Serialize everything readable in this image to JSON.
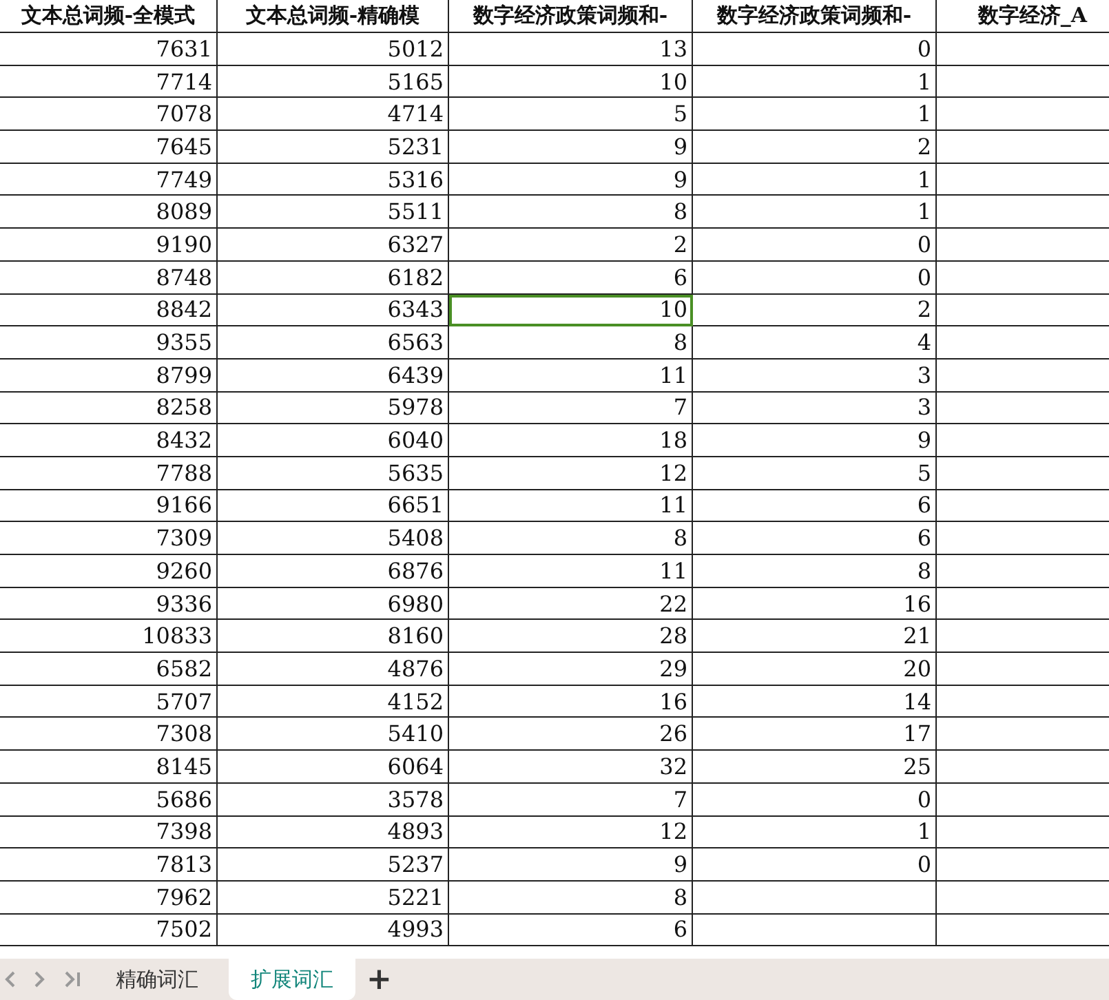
{
  "table": {
    "columns": [
      "文本总词频-全模式",
      "文本总词频-精确模",
      "数字经济政策词频和-",
      "数字经济政策词频和-",
      "数字经济_A"
    ],
    "rows": [
      {
        "cells": [
          {
            "text": "7631",
            "selected": false
          },
          {
            "text": "5012",
            "selected": false
          },
          {
            "text": "13",
            "selected": false
          },
          {
            "text": "0",
            "selected": false
          }
        ]
      },
      {
        "cells": [
          {
            "text": "7714",
            "selected": false
          },
          {
            "text": "5165",
            "selected": false
          },
          {
            "text": "10",
            "selected": false
          },
          {
            "text": "1",
            "selected": false
          }
        ]
      },
      {
        "cells": [
          {
            "text": "7078",
            "selected": false
          },
          {
            "text": "4714",
            "selected": false
          },
          {
            "text": "5",
            "selected": false
          },
          {
            "text": "1",
            "selected": false
          }
        ]
      },
      {
        "cells": [
          {
            "text": "7645",
            "selected": false
          },
          {
            "text": "5231",
            "selected": false
          },
          {
            "text": "9",
            "selected": false
          },
          {
            "text": "2",
            "selected": false
          }
        ]
      },
      {
        "cells": [
          {
            "text": "7749",
            "selected": false
          },
          {
            "text": "5316",
            "selected": false
          },
          {
            "text": "9",
            "selected": false
          },
          {
            "text": "1",
            "selected": false
          }
        ]
      },
      {
        "cells": [
          {
            "text": "8089",
            "selected": false
          },
          {
            "text": "5511",
            "selected": false
          },
          {
            "text": "8",
            "selected": false
          },
          {
            "text": "1",
            "selected": false
          }
        ]
      },
      {
        "cells": [
          {
            "text": "9190",
            "selected": false
          },
          {
            "text": "6327",
            "selected": false
          },
          {
            "text": "2",
            "selected": false
          },
          {
            "text": "0",
            "selected": false
          }
        ]
      },
      {
        "cells": [
          {
            "text": "8748",
            "selected": false
          },
          {
            "text": "6182",
            "selected": false
          },
          {
            "text": "6",
            "selected": false
          },
          {
            "text": "0",
            "selected": false
          }
        ]
      },
      {
        "cells": [
          {
            "text": "8842",
            "selected": false
          },
          {
            "text": "6343",
            "selected": false
          },
          {
            "text": "10",
            "selected": true
          },
          {
            "text": "2",
            "selected": false
          }
        ]
      },
      {
        "cells": [
          {
            "text": "9355",
            "selected": false
          },
          {
            "text": "6563",
            "selected": false
          },
          {
            "text": "8",
            "selected": false
          },
          {
            "text": "4",
            "selected": false
          }
        ]
      },
      {
        "cells": [
          {
            "text": "8799",
            "selected": false
          },
          {
            "text": "6439",
            "selected": false
          },
          {
            "text": "11",
            "selected": false
          },
          {
            "text": "3",
            "selected": false
          }
        ]
      },
      {
        "cells": [
          {
            "text": "8258",
            "selected": false
          },
          {
            "text": "5978",
            "selected": false
          },
          {
            "text": "7",
            "selected": false
          },
          {
            "text": "3",
            "selected": false
          }
        ]
      },
      {
        "cells": [
          {
            "text": "8432",
            "selected": false
          },
          {
            "text": "6040",
            "selected": false
          },
          {
            "text": "18",
            "selected": false
          },
          {
            "text": "9",
            "selected": false
          }
        ]
      },
      {
        "cells": [
          {
            "text": "7788",
            "selected": false
          },
          {
            "text": "5635",
            "selected": false
          },
          {
            "text": "12",
            "selected": false
          },
          {
            "text": "5",
            "selected": false
          }
        ]
      },
      {
        "cells": [
          {
            "text": "9166",
            "selected": false
          },
          {
            "text": "6651",
            "selected": false
          },
          {
            "text": "11",
            "selected": false
          },
          {
            "text": "6",
            "selected": false
          }
        ]
      },
      {
        "cells": [
          {
            "text": "7309",
            "selected": false
          },
          {
            "text": "5408",
            "selected": false
          },
          {
            "text": "8",
            "selected": false
          },
          {
            "text": "6",
            "selected": false
          }
        ]
      },
      {
        "cells": [
          {
            "text": "9260",
            "selected": false
          },
          {
            "text": "6876",
            "selected": false
          },
          {
            "text": "11",
            "selected": false
          },
          {
            "text": "8",
            "selected": false
          }
        ]
      },
      {
        "cells": [
          {
            "text": "9336",
            "selected": false
          },
          {
            "text": "6980",
            "selected": false
          },
          {
            "text": "22",
            "selected": false
          },
          {
            "text": "16",
            "selected": false
          }
        ]
      },
      {
        "cells": [
          {
            "text": "10833",
            "selected": false
          },
          {
            "text": "8160",
            "selected": false
          },
          {
            "text": "28",
            "selected": false
          },
          {
            "text": "21",
            "selected": false
          }
        ]
      },
      {
        "cells": [
          {
            "text": "6582",
            "selected": false
          },
          {
            "text": "4876",
            "selected": false
          },
          {
            "text": "29",
            "selected": false
          },
          {
            "text": "20",
            "selected": false
          }
        ]
      },
      {
        "cells": [
          {
            "text": "5707",
            "selected": false
          },
          {
            "text": "4152",
            "selected": false
          },
          {
            "text": "16",
            "selected": false
          },
          {
            "text": "14",
            "selected": false
          }
        ]
      },
      {
        "cells": [
          {
            "text": "7308",
            "selected": false
          },
          {
            "text": "5410",
            "selected": false
          },
          {
            "text": "26",
            "selected": false
          },
          {
            "text": "17",
            "selected": false
          }
        ]
      },
      {
        "cells": [
          {
            "text": "8145",
            "selected": false
          },
          {
            "text": "6064",
            "selected": false
          },
          {
            "text": "32",
            "selected": false
          },
          {
            "text": "25",
            "selected": false
          }
        ]
      },
      {
        "cells": [
          {
            "text": "5686",
            "selected": false
          },
          {
            "text": "3578",
            "selected": false
          },
          {
            "text": "7",
            "selected": false
          },
          {
            "text": "0",
            "selected": false
          }
        ]
      },
      {
        "cells": [
          {
            "text": "7398",
            "selected": false
          },
          {
            "text": "4893",
            "selected": false
          },
          {
            "text": "12",
            "selected": false
          },
          {
            "text": "1",
            "selected": false
          }
        ]
      },
      {
        "cells": [
          {
            "text": "7813",
            "selected": false
          },
          {
            "text": "5237",
            "selected": false
          },
          {
            "text": "9",
            "selected": false
          },
          {
            "text": "0",
            "selected": false
          }
        ]
      },
      {
        "cells": [
          {
            "text": "7962",
            "selected": false
          },
          {
            "text": "5221",
            "selected": false
          },
          {
            "text": "8",
            "selected": false
          }
        ]
      },
      {
        "cells": [
          {
            "text": "7502",
            "selected": false
          },
          {
            "text": "4993",
            "selected": false
          },
          {
            "text": "6",
            "selected": false
          }
        ]
      }
    ]
  },
  "sheet_tabs": [
    {
      "label": "精确词汇",
      "selected": false
    },
    {
      "label": "扩展词汇",
      "selected": true
    }
  ],
  "add_sheet": "+"
}
